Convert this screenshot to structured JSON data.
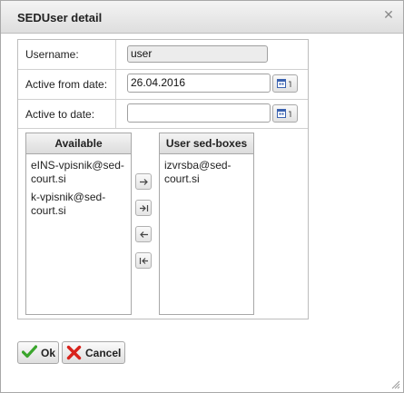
{
  "dialog": {
    "title": "SEDUser detail",
    "close_icon": "close-icon"
  },
  "form": {
    "username_label": "Username:",
    "username_value": "user",
    "active_from_label": "Active from date:",
    "active_from_value": "26.04.2016",
    "active_to_label": "Active to date:",
    "active_to_value": ""
  },
  "available": {
    "header": "Available",
    "items": [
      "eINS-vpisnik@sed-court.si",
      "k-vpisnik@sed-court.si"
    ]
  },
  "user_boxes": {
    "header": "User sed-boxes",
    "items": [
      "izvrsba@sed-court.si"
    ]
  },
  "mover_icons": [
    "move-right-icon",
    "move-all-right-icon",
    "move-left-icon",
    "move-all-left-icon"
  ],
  "buttons": {
    "ok": "Ok",
    "cancel": "Cancel"
  },
  "colors": {
    "ok_check": "#3aa52c",
    "cancel_x": "#d8231c",
    "calendar_icon": "#3a62b0"
  }
}
